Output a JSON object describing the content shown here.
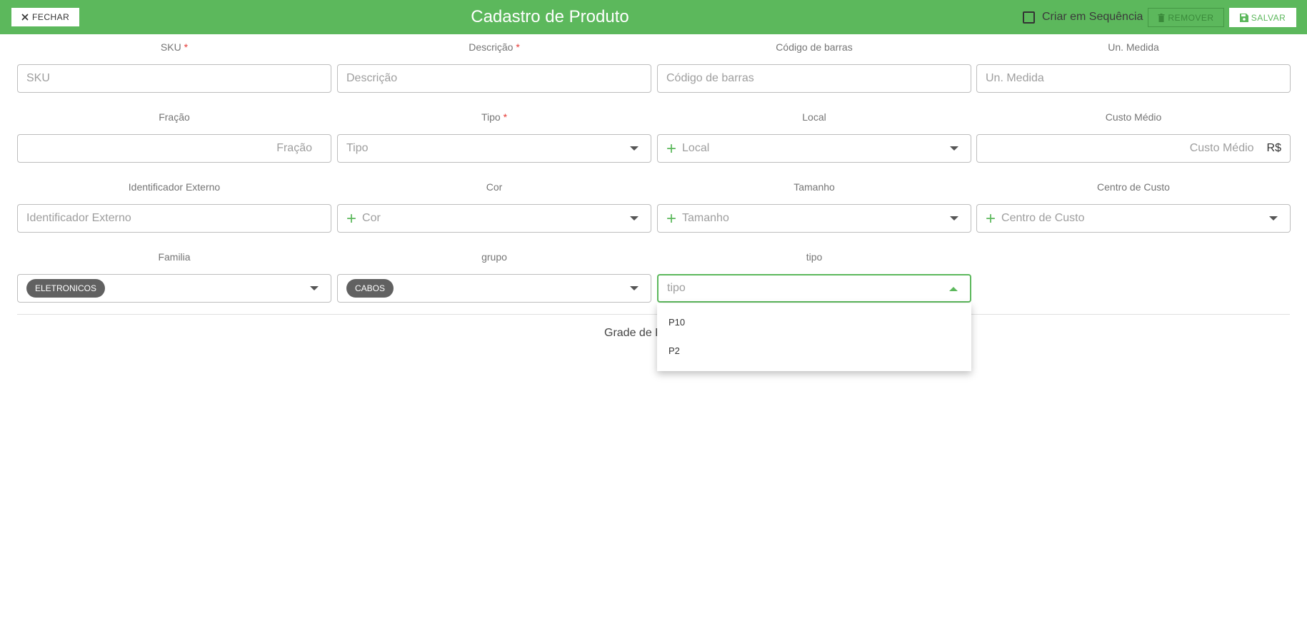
{
  "header": {
    "close_label": "FECHAR",
    "close_icon": "close-icon",
    "title": "Cadastro de Produto",
    "sequence_label": "Criar em Sequência",
    "remove_label": "REMOVER",
    "save_label": "SALVAR",
    "accent_color": "#5cb85c"
  },
  "form": {
    "sku": {
      "label": "SKU",
      "placeholder": "SKU",
      "required": "*"
    },
    "descricao": {
      "label": "Descrição",
      "placeholder": "Descrição",
      "required": "*"
    },
    "codigo_barras": {
      "label": "Código de barras",
      "placeholder": "Código de barras"
    },
    "un_medida": {
      "label": "Un. Medida",
      "placeholder": "Un. Medida"
    },
    "fracao": {
      "label": "Fração",
      "placeholder": "Fração"
    },
    "tipo": {
      "label": "Tipo",
      "placeholder": "Tipo",
      "required": "*"
    },
    "local": {
      "label": "Local",
      "placeholder": "Local"
    },
    "custo_medio": {
      "label": "Custo Médio",
      "placeholder": "Custo Médio",
      "suffix": "R$"
    },
    "identificador_externo": {
      "label": "Identificador Externo",
      "placeholder": "Identificador Externo"
    },
    "cor": {
      "label": "Cor",
      "placeholder": "Cor"
    },
    "tamanho": {
      "label": "Tamanho",
      "placeholder": "Tamanho"
    },
    "centro_custo": {
      "label": "Centro de Custo",
      "placeholder": "Centro de Custo"
    },
    "familia": {
      "label": "Familia",
      "chip": "ELETRONICOS"
    },
    "grupo": {
      "label": "grupo",
      "chip": "CABOS"
    },
    "tipo2": {
      "label": "tipo",
      "placeholder": "tipo",
      "options": [
        "P10",
        "P2"
      ]
    }
  },
  "grade_label": "Grade de P"
}
